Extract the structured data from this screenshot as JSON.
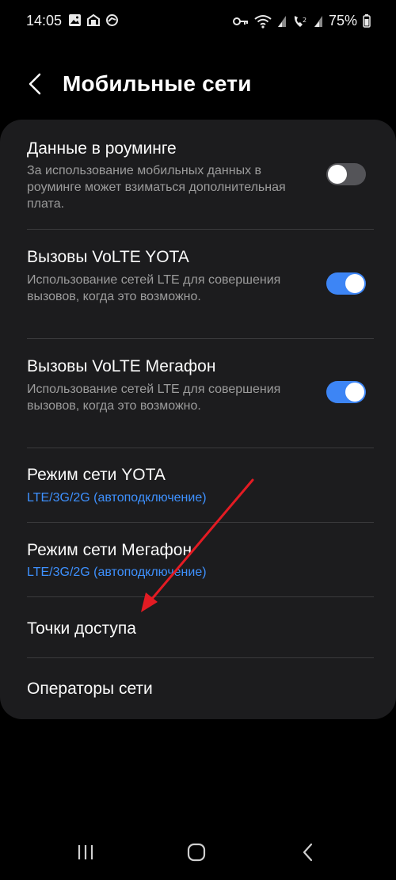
{
  "status_bar": {
    "time": "14:05",
    "battery_percent": "75%",
    "left_icons": [
      "image-icon",
      "tools-icon",
      "sync-icon"
    ],
    "right_icons": [
      "vpn-key-icon",
      "wifi-icon",
      "signal-icon",
      "volte-call-icon",
      "signal-icon",
      "battery-icon"
    ]
  },
  "header": {
    "title": "Мобильные сети"
  },
  "settings": {
    "roaming": {
      "title": "Данные в роуминге",
      "description": "За использование мобильных данных в роуминге может взиматься дополнительная плата.",
      "enabled": false
    },
    "volte_yota": {
      "title": "Вызовы VoLTE YOTA",
      "description": "Использование сетей LTE для совершения вызовов, когда это возможно.",
      "enabled": true
    },
    "volte_megafon": {
      "title": "Вызовы VoLTE Мегафон",
      "description": "Использование сетей LTE для совершения вызовов, когда это возможно.",
      "enabled": true
    },
    "network_mode_yota": {
      "title": "Режим сети YOTA",
      "value": "LTE/3G/2G (автоподключение)"
    },
    "network_mode_megafon": {
      "title": "Режим сети Мегафон",
      "value": "LTE/3G/2G (автоподключение)"
    },
    "access_points": {
      "title": "Точки доступа"
    },
    "network_operators": {
      "title": "Операторы сети"
    }
  },
  "colors": {
    "background": "#000000",
    "card": "#1c1c1e",
    "accent": "#3e91ff",
    "toggle_on": "#3d85f5",
    "annotation_arrow": "#e31b23"
  },
  "nav_bar": {
    "buttons": [
      "recent-apps-icon",
      "home-icon",
      "back-icon"
    ]
  }
}
